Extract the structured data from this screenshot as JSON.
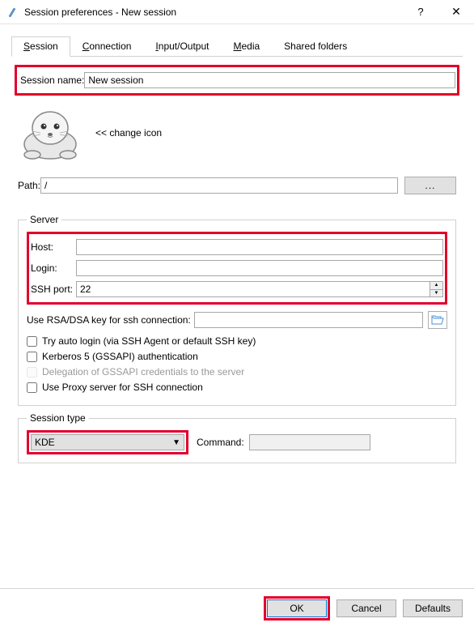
{
  "window": {
    "title": "Session preferences - New session"
  },
  "tabs": {
    "session": "Session",
    "connection": "Connection",
    "io": "Input/Output",
    "media": "Media",
    "shared": "Shared folders"
  },
  "session_name": {
    "label": "Session name:",
    "value": "New session"
  },
  "change_icon": "<< change icon",
  "path": {
    "label": "Path:",
    "value": "/",
    "browse": "..."
  },
  "server": {
    "legend": "Server",
    "host_label": "Host:",
    "host_value": "",
    "login_label": "Login:",
    "login_value": "",
    "ssh_label": "SSH port:",
    "ssh_value": "22",
    "rsa_label": "Use RSA/DSA key for ssh connection:",
    "rsa_value": "",
    "auto_login": "Try auto login (via SSH Agent or default SSH key)",
    "kerberos": "Kerberos 5 (GSSAPI) authentication",
    "delegation": "Delegation of GSSAPI credentials to the server",
    "proxy": "Use Proxy server for SSH connection"
  },
  "session_type": {
    "legend": "Session type",
    "selected": "KDE",
    "command_label": "Command:",
    "command_value": ""
  },
  "buttons": {
    "ok": "OK",
    "cancel": "Cancel",
    "defaults": "Defaults"
  }
}
